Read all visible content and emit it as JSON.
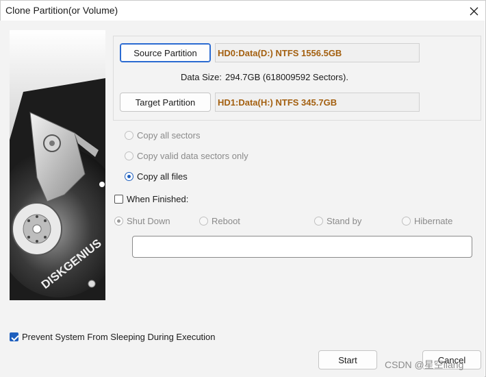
{
  "window": {
    "title": "Clone Partition(or Volume)",
    "close_icon": "close-icon"
  },
  "image_panel": {
    "brand_logo": "DISKGENIUS"
  },
  "partitions": {
    "source_button_label": "Source Partition",
    "source_value": "HD0:Data(D:) NTFS 1556.5GB",
    "data_size_label": "Data Size:",
    "data_size_value": "294.7GB (618009592 Sectors).",
    "target_button_label": "Target Partition",
    "target_value": "HD1:Data(H:) NTFS 345.7GB",
    "value_color": "#a35f0f"
  },
  "copy_mode": {
    "options": [
      {
        "label": "Copy all sectors",
        "selected": false,
        "enabled": false
      },
      {
        "label": "Copy valid data sectors only",
        "selected": false,
        "enabled": false
      },
      {
        "label": "Copy all files",
        "selected": true,
        "enabled": true
      }
    ]
  },
  "when_finished": {
    "label": "When Finished:",
    "checked": false,
    "options": [
      {
        "label": "Shut Down",
        "selected": true,
        "enabled": false
      },
      {
        "label": "Reboot",
        "selected": false,
        "enabled": false
      },
      {
        "label": "Stand by",
        "selected": false,
        "enabled": false
      },
      {
        "label": "Hibernate",
        "selected": false,
        "enabled": false
      }
    ],
    "command_value": ""
  },
  "prevent_sleep": {
    "label": "Prevent System From Sleeping During Execution",
    "checked": true
  },
  "footer": {
    "start_label": "Start",
    "cancel_label": "Cancel",
    "watermark": "CSDN @星空liang"
  },
  "colors": {
    "accent": "#1e5fbe",
    "button_focus_border": "#2a6ad1",
    "background": "#f3f3f3"
  }
}
